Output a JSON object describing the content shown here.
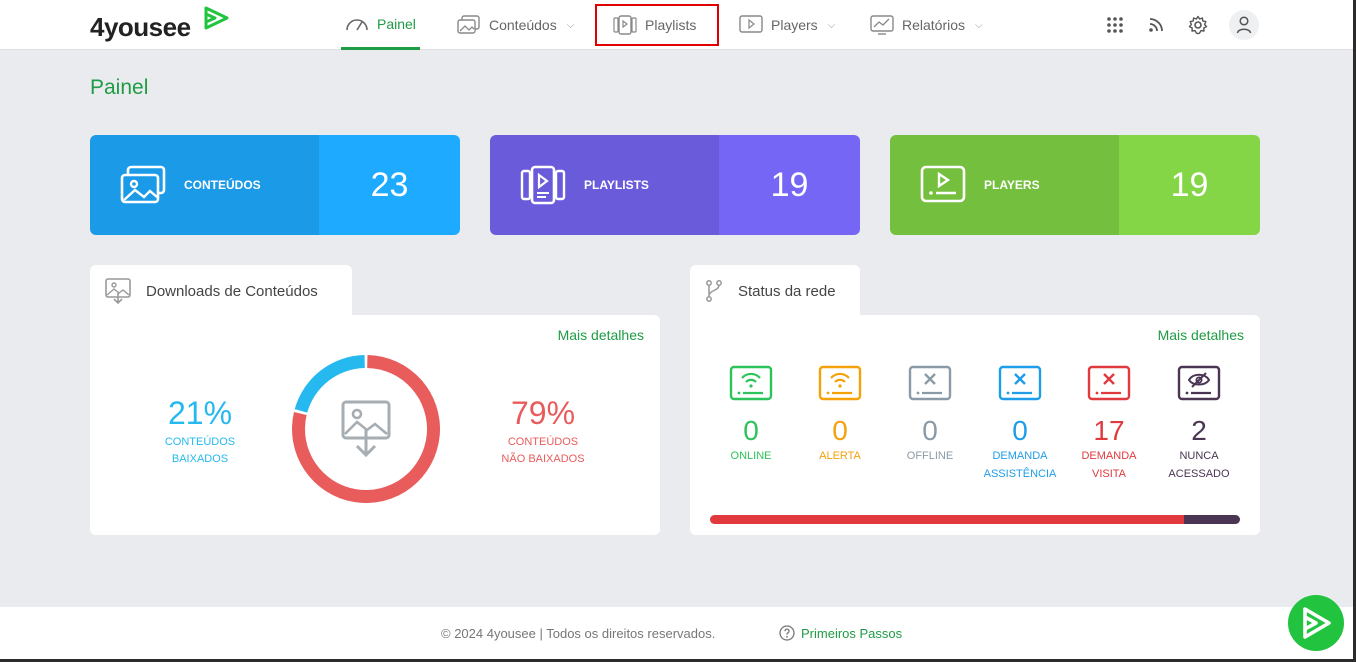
{
  "brand": {
    "name": "4yousee"
  },
  "nav": {
    "items": [
      {
        "label": "Painel"
      },
      {
        "label": "Conteúdos"
      },
      {
        "label": "Playlists"
      },
      {
        "label": "Players"
      },
      {
        "label": "Relatórios"
      }
    ]
  },
  "page": {
    "title": "Painel"
  },
  "stats": [
    {
      "label": "CONTEÚDOS",
      "value": "23"
    },
    {
      "label": "PLAYLISTS",
      "value": "19"
    },
    {
      "label": "PLAYERS",
      "value": "19"
    }
  ],
  "downloads": {
    "title": "Downloads de Conteúdos",
    "more": "Mais detalhes",
    "downloaded": {
      "pct": "21%",
      "line1": "CONTEÚDOS",
      "line2": "BAIXADOS",
      "fraction": 0.21
    },
    "not_downloaded": {
      "pct": "79%",
      "line1": "CONTEÚDOS",
      "line2": "NÃO BAIXADOS",
      "fraction": 0.79
    }
  },
  "network": {
    "title": "Status da rede",
    "more": "Mais detalhes",
    "statuses": [
      {
        "value": "0",
        "line1": "ONLINE",
        "line2": "",
        "color": "#2ec35a"
      },
      {
        "value": "0",
        "line1": "ALERTA",
        "line2": "",
        "color": "#f5a10a"
      },
      {
        "value": "0",
        "line1": "OFFLINE",
        "line2": "",
        "color": "#8a9aa6"
      },
      {
        "value": "0",
        "line1": "DEMANDA",
        "line2": "ASSISTÊNCIA",
        "color": "#1e9de8"
      },
      {
        "value": "17",
        "line1": "DEMANDA",
        "line2": "VISITA",
        "color": "#e0393e"
      },
      {
        "value": "2",
        "line1": "NUNCA",
        "line2": "ACESSADO",
        "color": "#4a3552"
      }
    ],
    "bar": [
      {
        "name": "DEMANDA VISITA",
        "fraction": 0.895,
        "color": "#e0393e"
      },
      {
        "name": "NUNCA ACESSADO",
        "fraction": 0.105,
        "color": "#4a3552"
      }
    ]
  },
  "footer": {
    "copyright": "© 2024 4yousee | Todos os direitos reservados.",
    "first_steps": "Primeiros Passos"
  },
  "colors": {
    "accent": "#1e9c45",
    "downloaded": "#25b9f0",
    "not_downloaded": "#e95c5c"
  }
}
